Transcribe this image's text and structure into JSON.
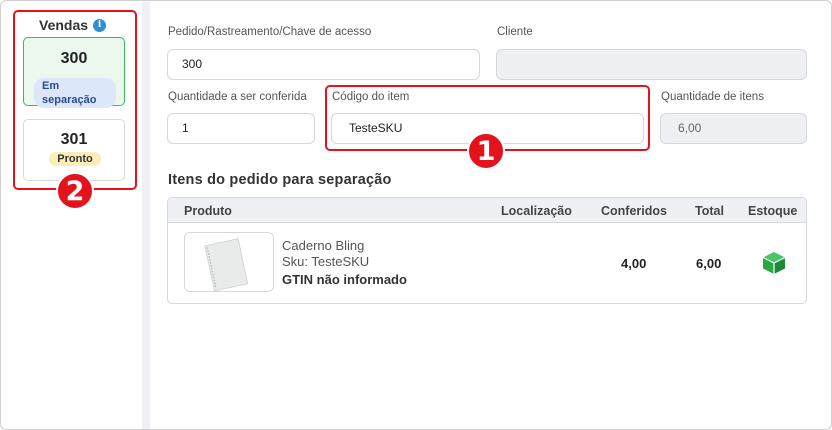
{
  "sidebar": {
    "title": "Vendas",
    "orders": [
      {
        "number": "300",
        "status": "Em separação"
      },
      {
        "number": "301",
        "status": "Pronto"
      }
    ]
  },
  "annotations": {
    "badge_1": "1",
    "badge_2": "2"
  },
  "form": {
    "order_label": "Pedido/Rastreamento/Chave de acesso",
    "order_value": "300",
    "client_label": "Cliente",
    "client_value": "",
    "qty_label": "Quantidade a ser conferida",
    "qty_value": "1",
    "item_code_label": "Código do item",
    "item_code_value": "TesteSKU",
    "item_qty_label": "Quantidade de itens",
    "item_qty_value": "6,00"
  },
  "items_section": {
    "title": "Itens do pedido para separação",
    "columns": [
      "Produto",
      "Localização",
      "Conferidos",
      "Total",
      "Estoque"
    ],
    "rows": [
      {
        "name": "Caderno Bling",
        "sku": "Sku: TesteSKU",
        "gtin": "GTIN não informado",
        "location": "",
        "checked": "4,00",
        "total": "6,00",
        "stock_icon": "green-box-icon"
      }
    ]
  },
  "colors": {
    "highlight": "#e3121b",
    "active_card_bg": "#eaf8ee",
    "active_card_border": "#3db85c",
    "status_sep_bg": "#dce8fa",
    "status_ok_bg": "#fbedb8",
    "stock_green": "#27a844"
  }
}
